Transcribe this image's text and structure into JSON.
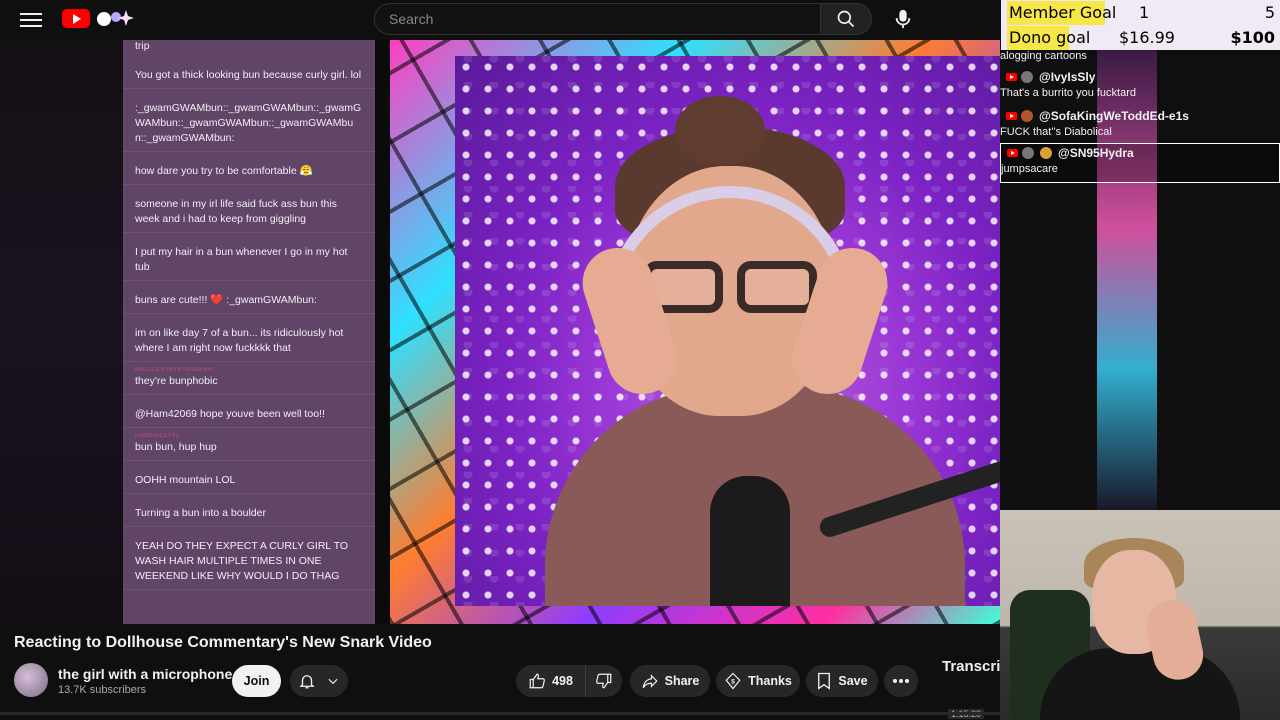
{
  "header": {
    "search_placeholder": "Search"
  },
  "goals": {
    "member": {
      "label": "Member Goal",
      "current": "1",
      "target": "5"
    },
    "dono": {
      "label": "Dono goal",
      "current": "$16.99",
      "target": "$100"
    }
  },
  "side_chat": {
    "top_text": "alogging cartoons",
    "items": [
      {
        "user": "@IvyIsSly",
        "msg": "That's a burrito you fucktard"
      },
      {
        "user": "@SofaKingWeToddEd-e1s",
        "msg": "FUCK that''s Diabolical"
      },
      {
        "user": "@SN95Hydra",
        "msg": "jumpsacare"
      }
    ]
  },
  "stream_chat": {
    "top_text": "trip",
    "messages": [
      {
        "user": "",
        "text": "You got a thick looking bun because curly girl. lol"
      },
      {
        "user": "",
        "text": ":_gwamGWAMbun::_gwamGWAMbun::_gwamGWAMbun::_gwamGWAMbun::_gwamGWAMbun::_gwamGWAMbun:"
      },
      {
        "user": "",
        "text": "how dare you try to be comfortable 😤"
      },
      {
        "user": "",
        "text": "someone in my irl life said fuck ass bun this week and i had to keep from giggling"
      },
      {
        "user": "",
        "text": "I put my hair in a bun whenever I go in my hot tub"
      },
      {
        "user": "",
        "text": "buns are cute!!! ❤️ :_gwamGWAMbun:"
      },
      {
        "user": "",
        "text": "im on like day 7 of a bun... its ridiculously hot where I am right now fuckkkk that"
      },
      {
        "user": "MILLICENTBYSTANDERR",
        "text": "they're bunphobic"
      },
      {
        "user": "",
        "text": "@Ham42069 hope youve been well too!!"
      },
      {
        "user": "KIMBERLEY91",
        "text": "bun bun, hup hup"
      },
      {
        "user": "",
        "text": "OOHH mountain LOL"
      },
      {
        "user": "",
        "text": "Turning a bun into a boulder"
      },
      {
        "user": "",
        "text": "YEAH DO THEY EXPECT A CURLY GIRL TO WASH HAIR MULTIPLE TIMES IN ONE WEEKEND LIKE WHY WOULD I DO THAG"
      }
    ]
  },
  "video": {
    "title": "Reacting to Dollhouse Commentary's New Snark Video",
    "channel": "the girl with a microphone",
    "subscribers": "13.7K subscribers",
    "join_label": "Join",
    "likes": "498",
    "share_label": "Share",
    "thanks_label": "Thanks",
    "save_label": "Save",
    "transcript_label": "Transcript",
    "timestamp": "1:15:28"
  },
  "colors": {
    "accent_red": "#ff0000",
    "goal_highlight": "#f7e64a",
    "chat_bg": "#785682"
  }
}
